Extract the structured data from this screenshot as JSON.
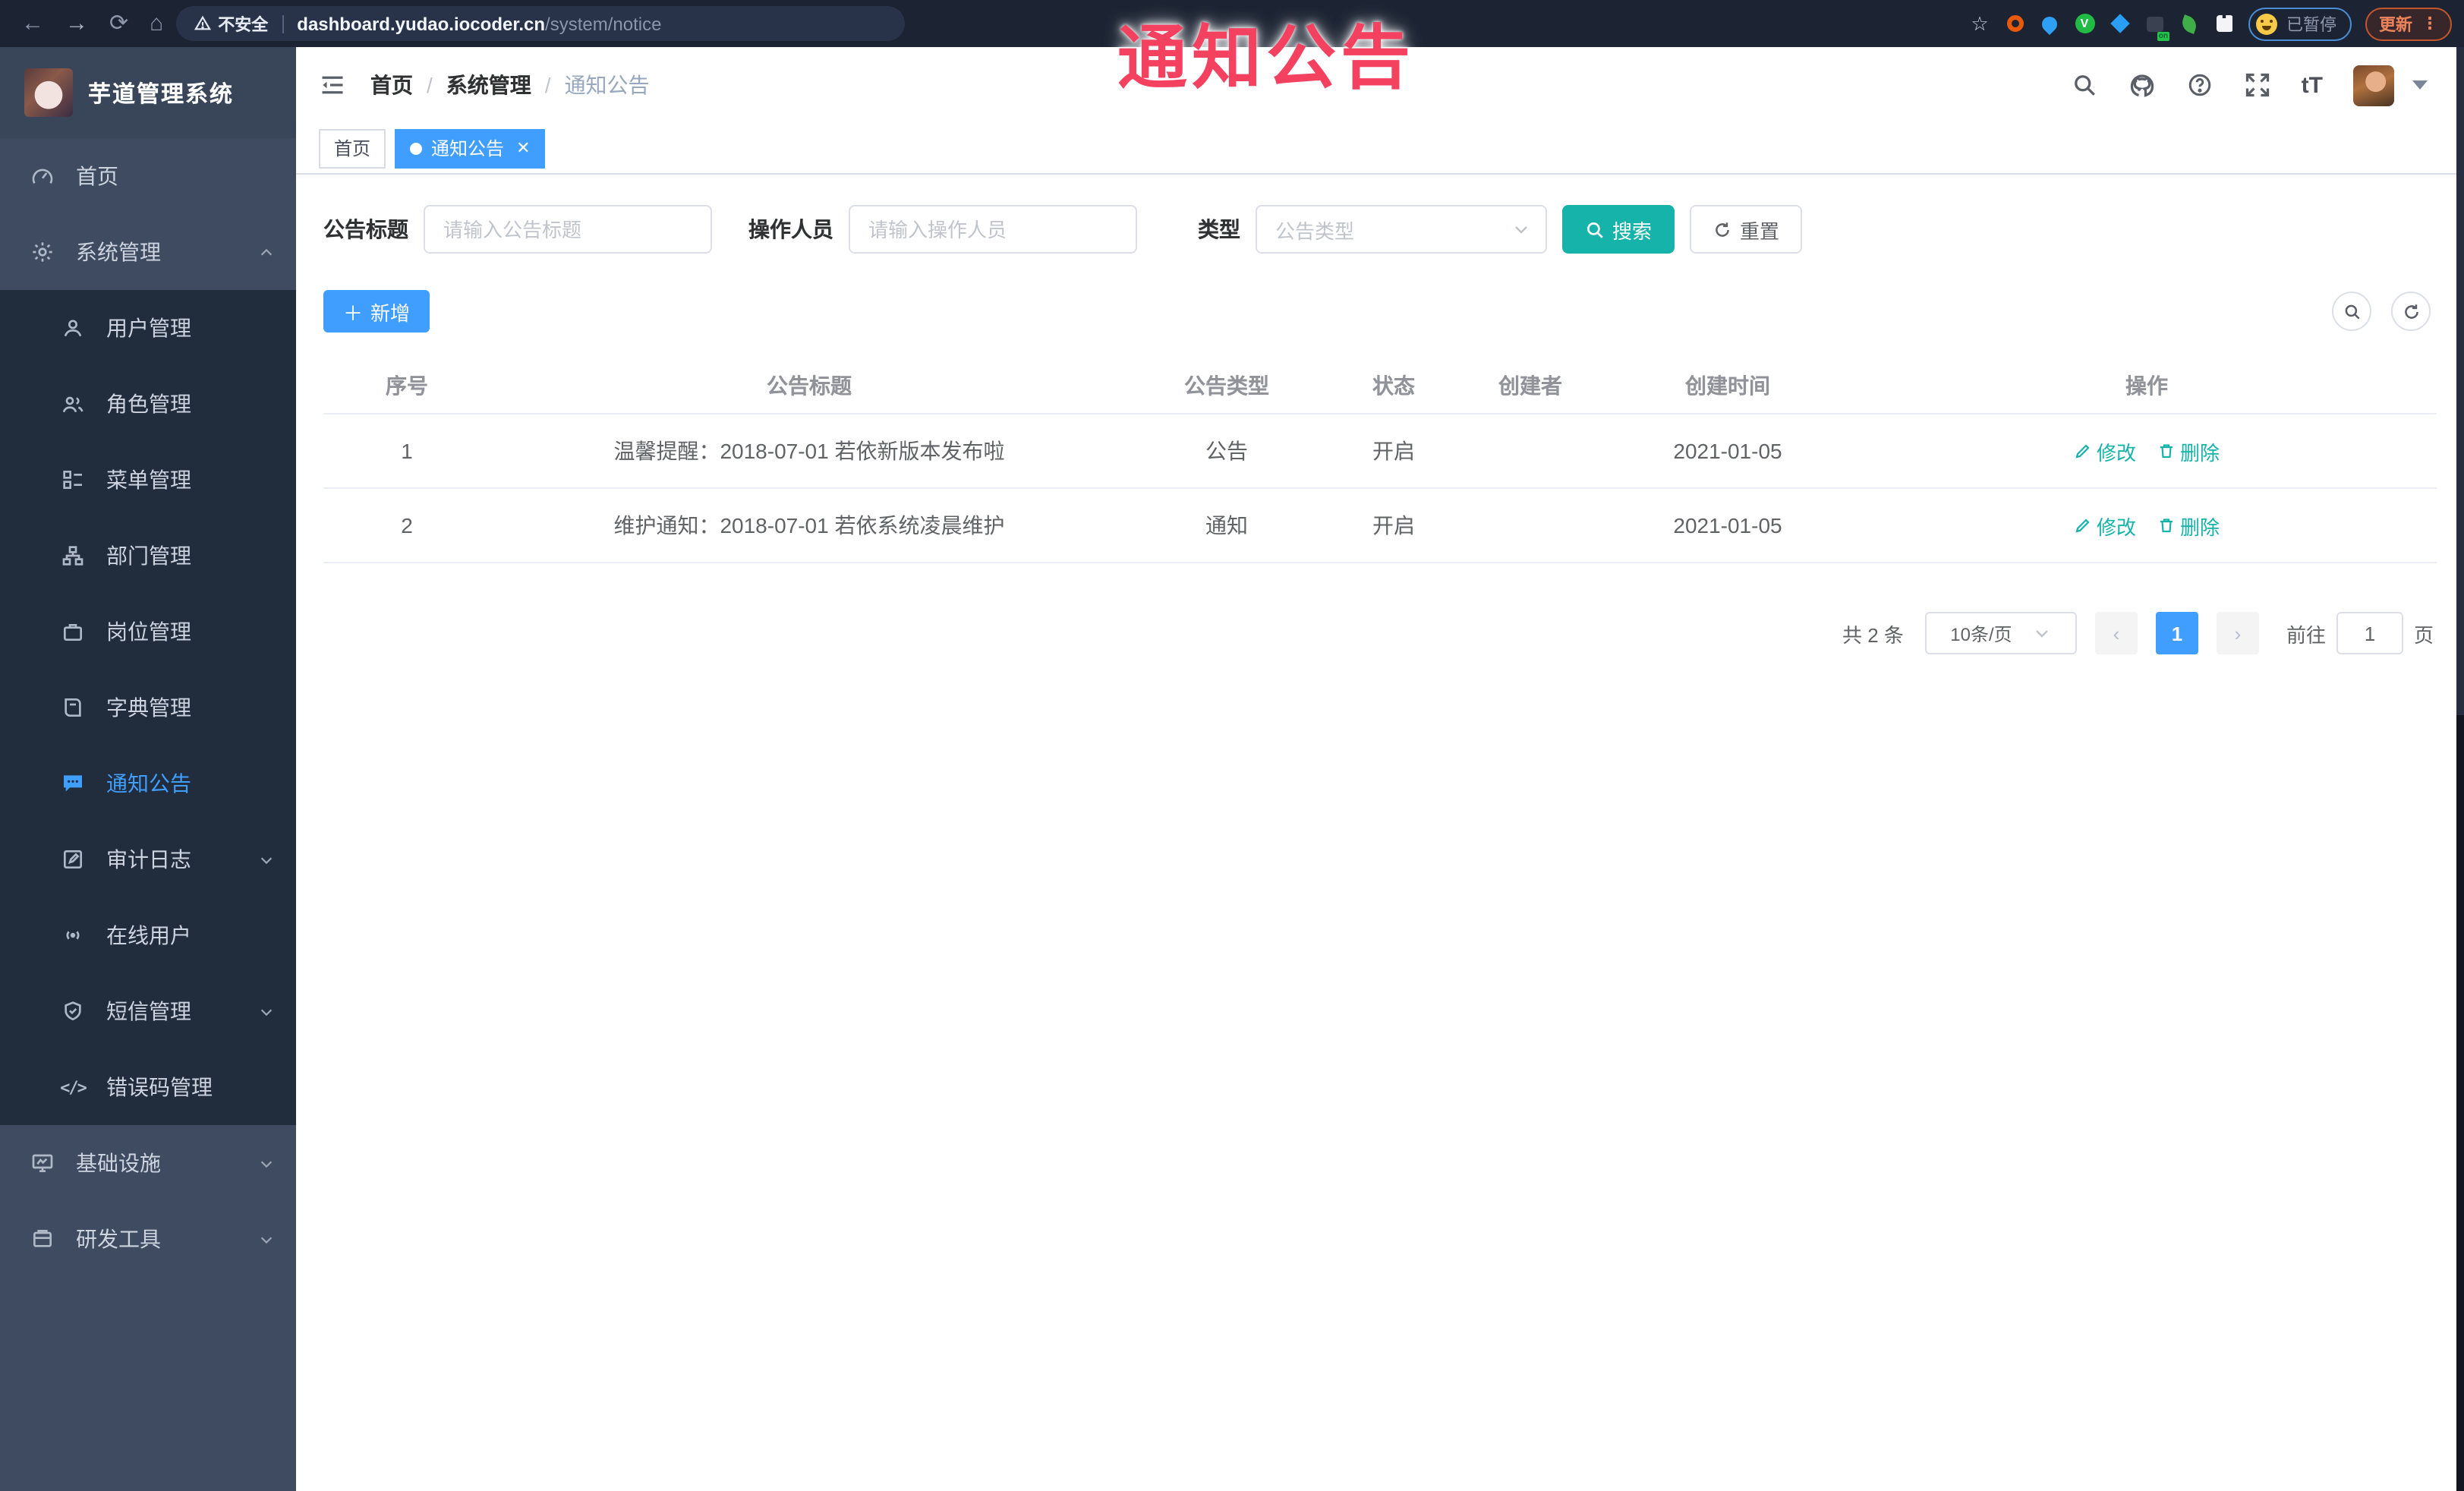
{
  "browser": {
    "warning": "不安全",
    "url_domain": "dashboard.yudao.iocoder.cn",
    "url_path": "/system/notice",
    "paused_label": "已暂停",
    "update_label": "更新",
    "ext_on_badge": "on"
  },
  "overlay": {
    "text": "通知公告"
  },
  "sidebar": {
    "title": "芋道管理系统",
    "items": [
      {
        "label": "首页"
      },
      {
        "label": "系统管理"
      },
      {
        "label": "用户管理"
      },
      {
        "label": "角色管理"
      },
      {
        "label": "菜单管理"
      },
      {
        "label": "部门管理"
      },
      {
        "label": "岗位管理"
      },
      {
        "label": "字典管理"
      },
      {
        "label": "通知公告"
      },
      {
        "label": "审计日志"
      },
      {
        "label": "在线用户"
      },
      {
        "label": "短信管理"
      },
      {
        "label": "错误码管理"
      },
      {
        "label": "基础设施"
      },
      {
        "label": "研发工具"
      }
    ]
  },
  "header": {
    "breadcrumb": [
      "首页",
      "系统管理",
      "通知公告"
    ],
    "separator": "/"
  },
  "tabs": {
    "home": "首页",
    "active": "通知公告"
  },
  "filters": {
    "title_label": "公告标题",
    "title_placeholder": "请输入公告标题",
    "operator_label": "操作人员",
    "operator_placeholder": "请输入操作人员",
    "type_label": "类型",
    "type_placeholder": "公告类型",
    "search_label": "搜索",
    "reset_label": "重置"
  },
  "toolbar": {
    "add_label": "新增"
  },
  "table": {
    "columns": [
      "序号",
      "公告标题",
      "公告类型",
      "状态",
      "创建者",
      "创建时间",
      "操作"
    ],
    "rows": [
      {
        "index": "1",
        "title": "温馨提醒：2018-07-01 若依新版本发布啦",
        "type": "公告",
        "status": "开启",
        "creator": "",
        "created_at": "2021-01-05",
        "edit_label": "修改",
        "delete_label": "删除"
      },
      {
        "index": "2",
        "title": "维护通知：2018-07-01 若依系统凌晨维护",
        "type": "通知",
        "status": "开启",
        "creator": "",
        "created_at": "2021-01-05",
        "edit_label": "修改",
        "delete_label": "删除"
      }
    ]
  },
  "pagination": {
    "total_text": "共 2 条",
    "page_size": "10条/页",
    "current_page": "1",
    "goto_label": "前往",
    "goto_value": "1",
    "page_suffix": "页"
  },
  "colors": {
    "accent_blue": "#409eff",
    "teal": "#16b3aa",
    "overlay_red": "#f4415f",
    "sidebar_bg": "#3e4b60",
    "submenu_bg": "#212c3c",
    "browser_bar_bg": "#1c2433"
  }
}
